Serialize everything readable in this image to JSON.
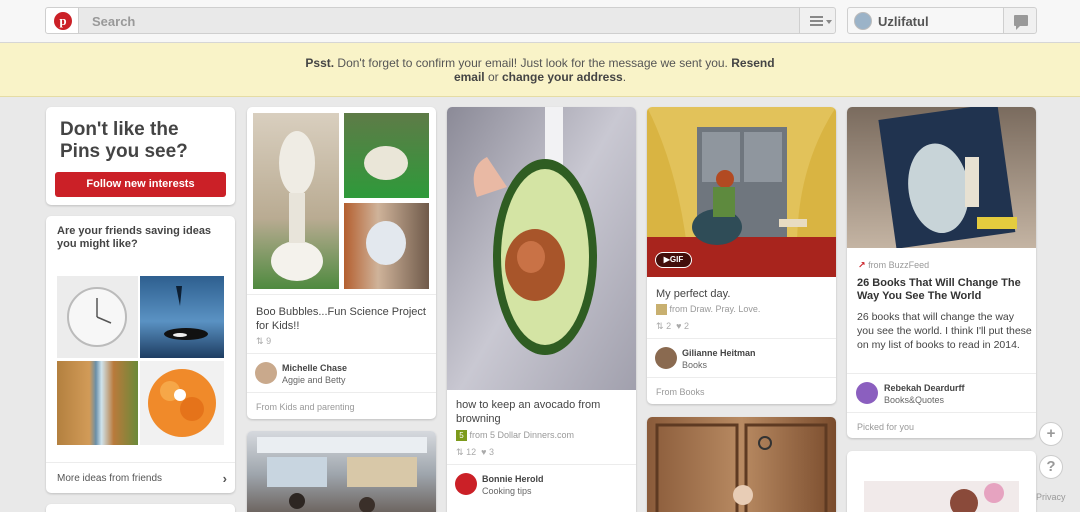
{
  "header": {
    "logo_letter": "p",
    "search_placeholder": "Search",
    "user_name": "Uzlifatul"
  },
  "banner": {
    "prefix": "Psst.",
    "text": "Don't forget to confirm your email! Just look for the message we sent you.",
    "resend_label": "Resend email",
    "or_text": "or",
    "change_label": "change your address",
    "end": "."
  },
  "sidebar": {
    "dislike_title_1": "Don't like the",
    "dislike_title_2": "Pins you see?",
    "follow_button": "Follow new interests",
    "friends_title": "Are your friends saving ideas you might like?",
    "more_ideas": "More ideas from friends"
  },
  "pins": [
    {
      "description": "Boo Bubbles...Fun Science Project for Kids!!",
      "repins": "9",
      "user": "Michelle Chase",
      "board": "Aggie and Betty",
      "source": "From Kids and parenting"
    },
    {
      "description": "how to keep an avocado from browning",
      "source_site": "from 5 Dollar Dinners.com",
      "repins": "12",
      "likes": "3",
      "user": "Bonnie Herold",
      "board": "Cooking tips"
    },
    {
      "badge": "GIF",
      "description": "My perfect day.",
      "source_site": "from Draw. Pray. Love.",
      "repins": "2",
      "likes": "2",
      "user": "Gilianne Heitman",
      "board": "Books",
      "source": "From Books"
    },
    {
      "source_site": "from BuzzFeed",
      "title": "26 Books That Will Change The Way You See The World",
      "description": "26 books that will change the way you see the world. I think I'll put these on my list of books to read in 2014.",
      "user": "Rebekah Deardurff",
      "board": "Books&Quotes",
      "picked": "Picked for you"
    }
  ],
  "side": {
    "add": "+",
    "help": "?",
    "privacy": "Privacy"
  },
  "colors": {
    "brand_red": "#cb2027",
    "banner_bg": "#f9f3c8"
  }
}
